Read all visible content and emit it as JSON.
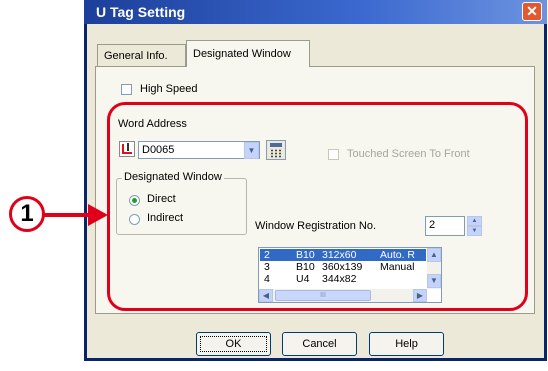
{
  "window": {
    "title": "U Tag Setting"
  },
  "tabs": [
    {
      "label": "General Info."
    },
    {
      "label": "Designated Window"
    }
  ],
  "high_speed": {
    "label": "High Speed",
    "checked": false
  },
  "word_address": {
    "label": "Word Address",
    "value": "D0065"
  },
  "touched_screen": {
    "label": "Touched Screen To Front",
    "checked": false,
    "enabled": false
  },
  "designated_window": {
    "group_label": "Designated Window",
    "options": [
      {
        "label": "Direct",
        "selected": true
      },
      {
        "label": "Indirect",
        "selected": false
      }
    ]
  },
  "window_registration": {
    "label": "Window Registration No.",
    "value": "2"
  },
  "window_list": {
    "rows": [
      {
        "no": "2",
        "type": "B10",
        "size": "312x60",
        "mode": "Auto. R"
      },
      {
        "no": "3",
        "type": "B10",
        "size": "360x139",
        "mode": "Manual"
      },
      {
        "no": "4",
        "type": "U4",
        "size": "344x82",
        "mode": ""
      }
    ],
    "selected_index": 0,
    "hscroll_thumb_text": "III"
  },
  "buttons": {
    "ok": "OK",
    "cancel": "Cancel",
    "help": "Help"
  },
  "callout": {
    "number": "1"
  },
  "colors": {
    "highlight": "#e0001a",
    "titlebar": "#1c3f9a",
    "selection": "#316ac5"
  }
}
